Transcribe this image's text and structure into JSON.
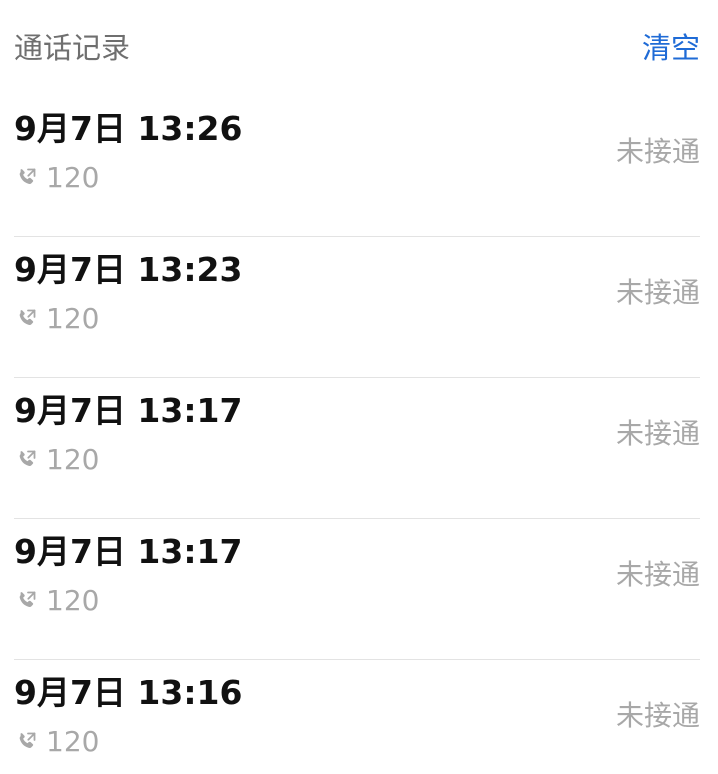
{
  "header": {
    "title": "通话记录",
    "clear_label": "清空"
  },
  "records": [
    {
      "time": "9月7日 13:26",
      "number": "120",
      "status": "未接通",
      "icon": "outgoing-call-icon"
    },
    {
      "time": "9月7日 13:23",
      "number": "120",
      "status": "未接通",
      "icon": "outgoing-call-icon"
    },
    {
      "time": "9月7日 13:17",
      "number": "120",
      "status": "未接通",
      "icon": "outgoing-call-icon"
    },
    {
      "time": "9月7日 13:17",
      "number": "120",
      "status": "未接通",
      "icon": "outgoing-call-icon"
    },
    {
      "time": "9月7日 13:16",
      "number": "120",
      "status": "未接通",
      "icon": "outgoing-call-icon"
    }
  ],
  "colors": {
    "accent": "#1f6bd6",
    "primary_text": "#111111",
    "secondary_text": "#a8a8a8",
    "header_text": "#6f6f6f",
    "divider": "#e3e3e3"
  }
}
